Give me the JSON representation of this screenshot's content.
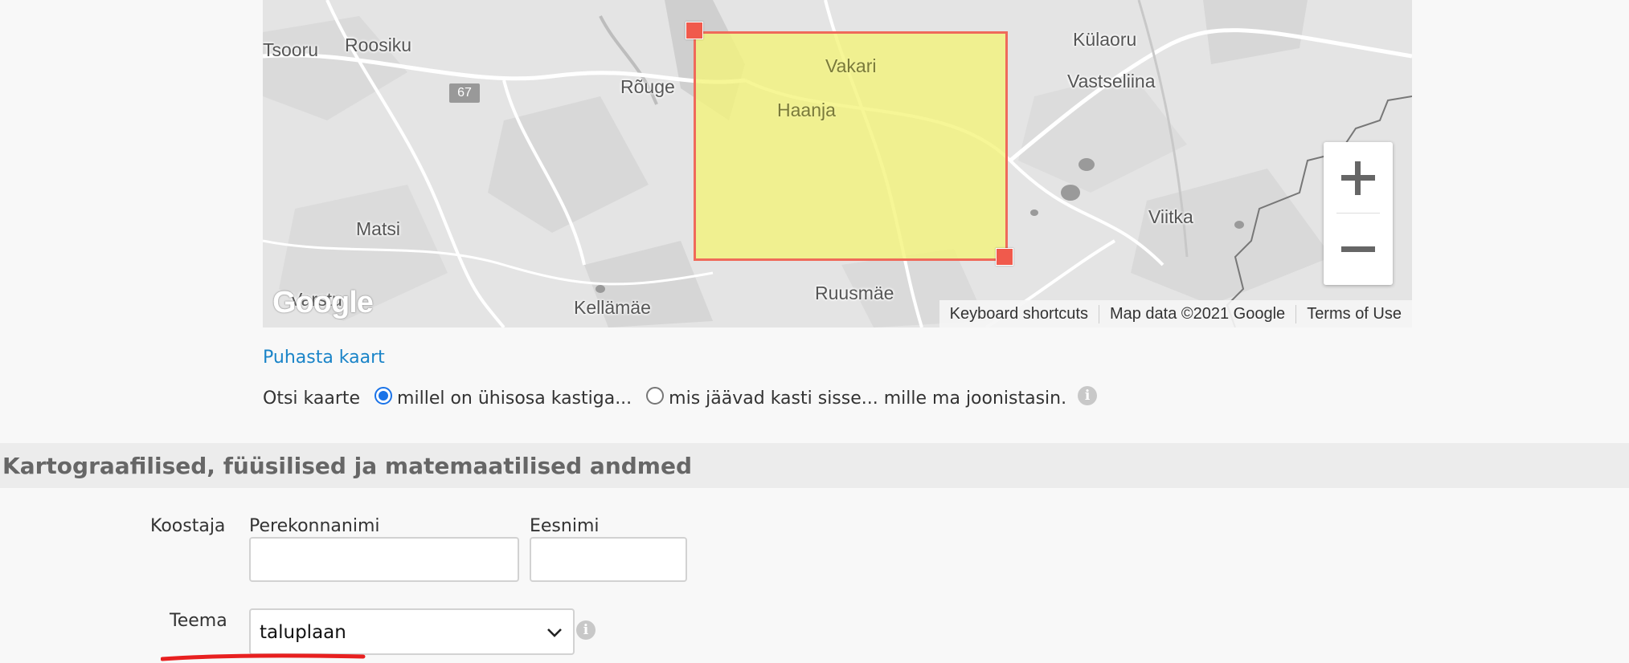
{
  "map": {
    "places": {
      "tsooru": "Tsooru",
      "roosiku": "Roosiku",
      "rouge": "Rõuge",
      "vakari": "Vakari",
      "haanja": "Haanja",
      "kulaoru": "Külaoru",
      "vastseliina": "Vastseliina",
      "matsi": "Matsi",
      "viitka": "Viitka",
      "varstu": "Varstu",
      "kellamae": "Kellämäe",
      "ruusmae": "Ruusmäe"
    },
    "road_number": "67",
    "logo": "Google",
    "attribution": {
      "shortcuts": "Keyboard shortcuts",
      "map_data": "Map data ©2021 Google",
      "terms": "Terms of Use"
    },
    "zoom_in_icon": "plus-icon",
    "zoom_out_icon": "minus-icon",
    "selection_color": "#f3f378",
    "selection_border_color": "#ef6a5a"
  },
  "clear_map_link": "Puhasta kaart",
  "search": {
    "label": "Otsi kaarte",
    "option_intersect": "millel on ühisosa kastiga...",
    "option_inside": "mis jäävad kasti sisse... mille ma joonistasin.",
    "selected": "option_intersect"
  },
  "section": {
    "title": "Kartograafilised, füüsilised ja matemaatilised andmed"
  },
  "form": {
    "author_label": "Koostaja",
    "surname_label": "Perekonnanimi",
    "surname_value": "",
    "firstname_label": "Eesnimi",
    "firstname_value": "",
    "theme_label": "Teema",
    "theme_value": "taluplaan"
  },
  "colors": {
    "link": "#1a84c8",
    "radio_accent": "#1a73e8",
    "underline": "#e82020"
  }
}
